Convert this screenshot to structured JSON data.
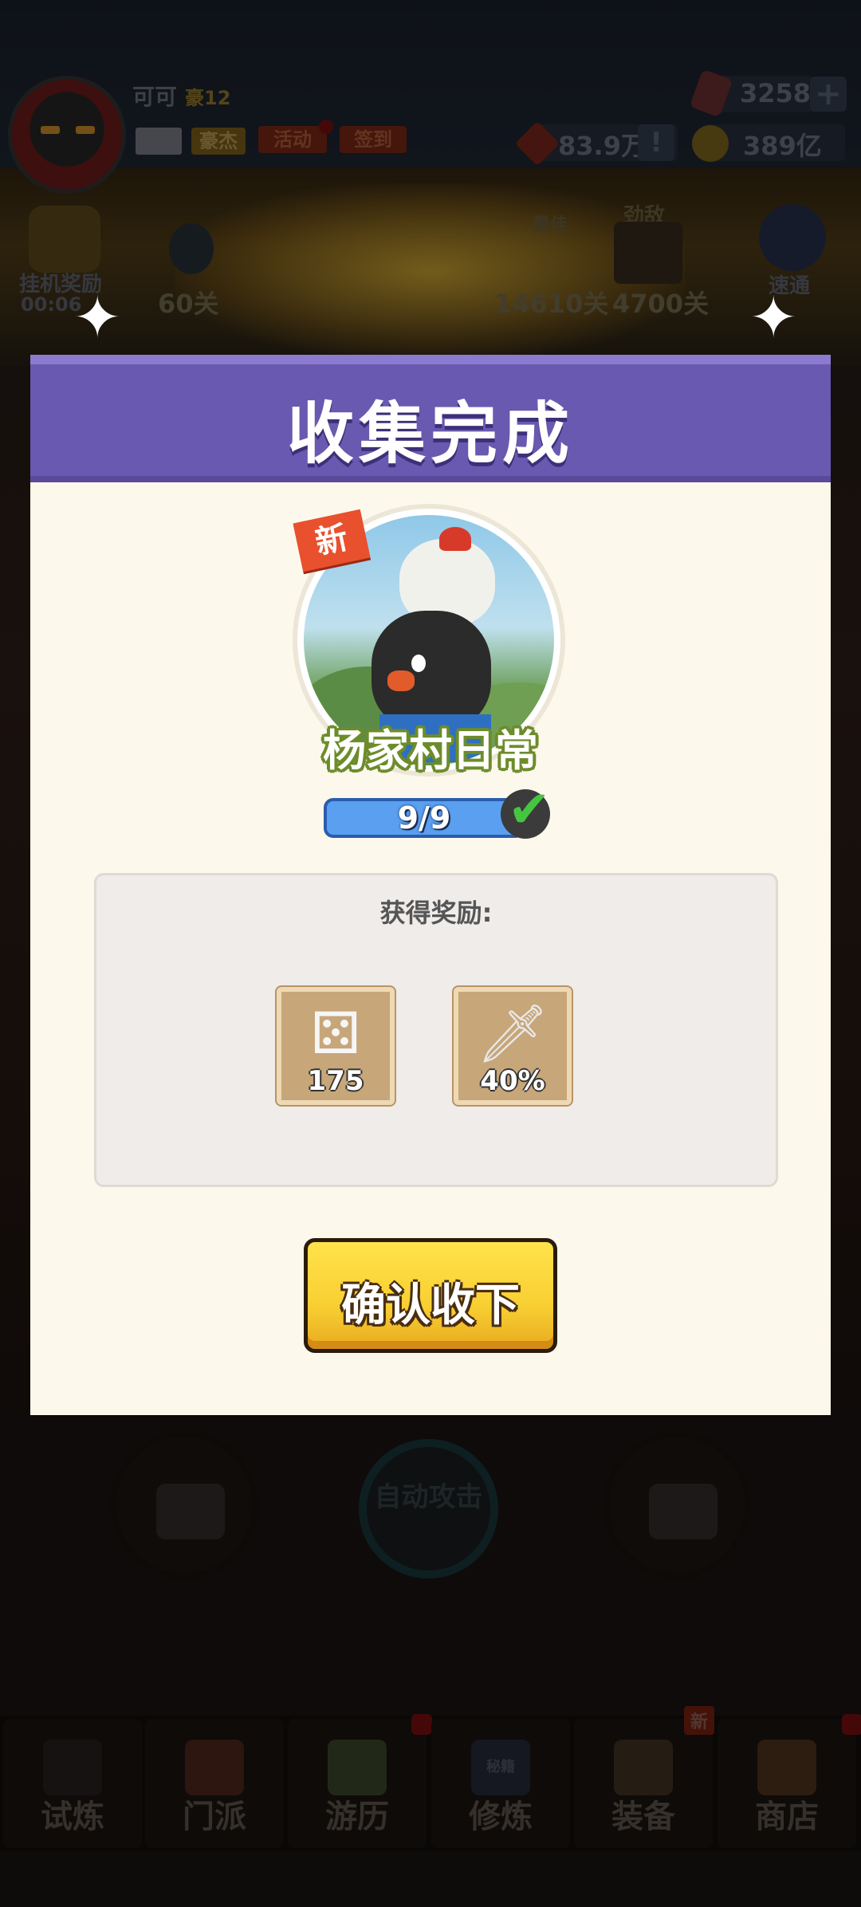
{
  "player": {
    "name": "可可",
    "vip": "豪12",
    "buttons": [
      "豪杰",
      "活动",
      "签到"
    ]
  },
  "resources": {
    "gems": "3258",
    "power": "83.9万",
    "coins": "389亿"
  },
  "hud": {
    "idle_reward_label": "挂机奖励",
    "idle_timer": "00:06",
    "current_stage": "60关",
    "best_label": "最佳",
    "best_stage": "14610关",
    "rival_label": "劲敌",
    "rival_stage": "4700关",
    "pass_label": "速通"
  },
  "controls": {
    "auto_attack": "自动攻击"
  },
  "tabs": [
    {
      "label": "试炼"
    },
    {
      "label": "门派"
    },
    {
      "label": "游历"
    },
    {
      "label": "修炼",
      "sign": "秘籍"
    },
    {
      "label": "装备",
      "badge": "新"
    },
    {
      "label": "商店"
    }
  ],
  "modal": {
    "title": "收集完成",
    "new_badge": "新",
    "card_name": "杨家村日常",
    "progress_text": "9/9",
    "progress_current": 9,
    "progress_total": 9,
    "reward_title": "获得奖励:",
    "rewards": [
      {
        "icon": "dice-icon",
        "value": "175"
      },
      {
        "icon": "sword-icon",
        "value": "40%"
      }
    ],
    "confirm_label": "确认收下"
  },
  "colors": {
    "modal_header": "#6a59b0",
    "modal_body": "#fdf8ec",
    "confirm_button": "#f8cf32",
    "progress_bar": "#3777d6",
    "check_mark": "#46c540"
  }
}
